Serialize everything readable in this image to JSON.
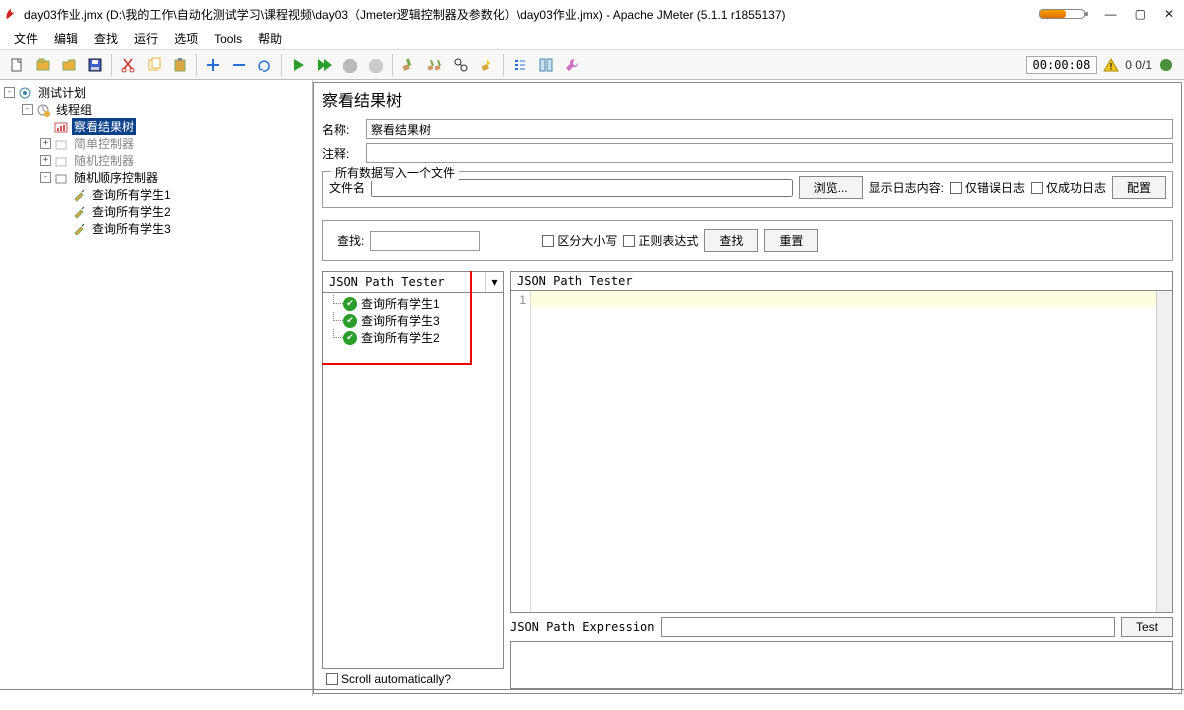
{
  "window": {
    "title": "day03作业.jmx (D:\\我的工作\\自动化测试学习\\课程视频\\day03（Jmeter逻辑控制器及参数化）\\day03作业.jmx) - Apache JMeter (5.1.1 r1855137)"
  },
  "menu": {
    "items": [
      "文件",
      "编辑",
      "查找",
      "运行",
      "选项",
      "Tools",
      "帮助"
    ]
  },
  "toolbar": {
    "timer": "00:00:08",
    "status": "0  0/1"
  },
  "tree": {
    "root": "测试计划",
    "thread_group": "线程组",
    "view_results": "察看结果树",
    "simple_ctrl": "简单控制器",
    "random_ctrl": "随机控制器",
    "random_order_ctrl": "随机顺序控制器",
    "sampler1": "查询所有学生1",
    "sampler2": "查询所有学生2",
    "sampler3": "查询所有学生3"
  },
  "panel": {
    "title": "察看结果树",
    "name_label": "名称:",
    "name_value": "察看结果树",
    "comment_label": "注释:",
    "file_legend": "所有数据写入一个文件",
    "filename_label": "文件名",
    "browse_btn": "浏览...",
    "show_log_label": "显示日志内容:",
    "only_err": "仅错误日志",
    "only_success": "仅成功日志",
    "configure_btn": "配置",
    "search_label": "查找:",
    "case_sensitive": "区分大小写",
    "regex": "正则表达式",
    "find_btn": "查找",
    "reset_btn": "重置",
    "renderer": "JSON Path Tester",
    "results": [
      "查询所有学生1",
      "查询所有学生3",
      "查询所有学生2"
    ],
    "scroll_auto": "Scroll automatically?",
    "tester_head": "JSON Path Tester",
    "gutter_line": "1",
    "expr_label": "JSON Path Expression",
    "test_btn": "Test"
  }
}
